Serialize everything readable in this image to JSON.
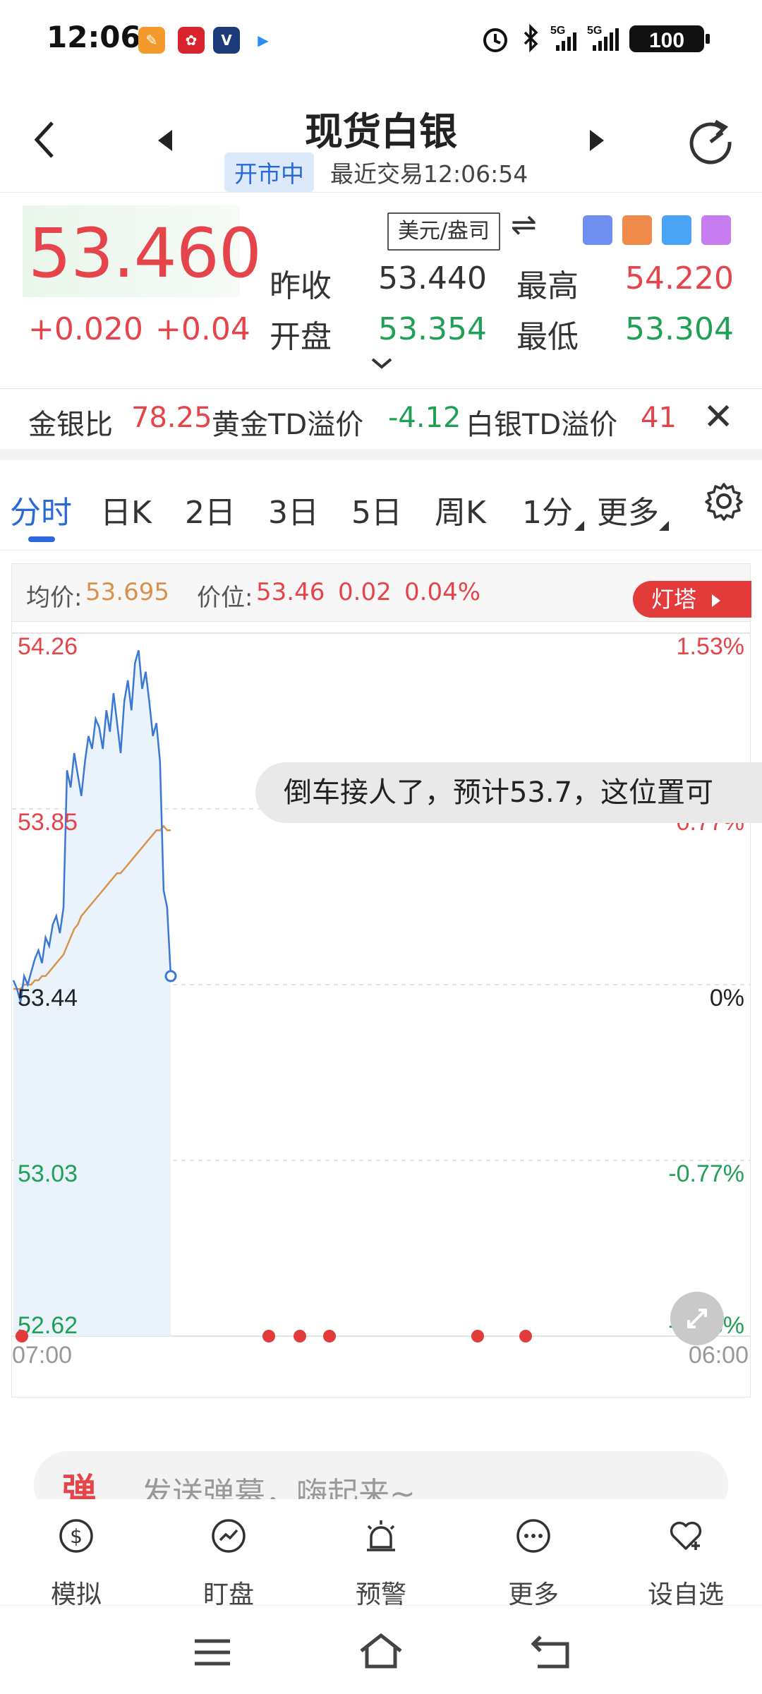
{
  "status_bar": {
    "time": "12:06",
    "battery": "100",
    "network1": "5G",
    "network2": "5G"
  },
  "header": {
    "title": "现货白银",
    "market_status": "开市中",
    "last_trade": "最近交易12:06:54"
  },
  "quote": {
    "price": "53.460",
    "change": "+0.020",
    "change_pct": "+0.04",
    "unit": "美元/盎司",
    "prev_close_label": "昨收",
    "prev_close": "53.440",
    "high_label": "最高",
    "high": "54.220",
    "open_label": "开盘",
    "open": "53.354",
    "low_label": "最低",
    "low": "53.304"
  },
  "ticker": {
    "item1_label": "金银比",
    "item1_value": "78.25",
    "item2_label": "黄金TD溢价",
    "item2_value": "-4.12",
    "item3_label": "白银TD溢价",
    "item3_value": "41"
  },
  "tabs": [
    "分时",
    "日K",
    "2日",
    "3日",
    "5日",
    "周K",
    "1分",
    "更多"
  ],
  "chart_header": {
    "avg_label": "均价:",
    "avg_value": "53.695",
    "pos_label": "价位:",
    "pos_value": "53.46",
    "pos_change": "0.02",
    "pos_pct": "0.04%",
    "dengta_label": "灯塔"
  },
  "comment": "倒车接人了，预计53.7，这位置可",
  "danmu_placeholder": "发送弹幕，嗨起来~",
  "danmu_icon_text": "弹",
  "bottom_nav": [
    "模拟",
    "盯盘",
    "预警",
    "更多",
    "设自选"
  ],
  "colors": {
    "up": "#e5444b",
    "down": "#1fa055",
    "accent": "#2a6ad8",
    "price_line": "#3a78d6",
    "avg_line": "#d9924a"
  },
  "chart_data": {
    "type": "line",
    "title": "",
    "x_start_label": "07:00",
    "x_end_label": "06:00",
    "y_left_ticks": [
      "54.26",
      "53.85",
      "53.44",
      "53.03",
      "52.62"
    ],
    "y_right_ticks": [
      "1.53%",
      "0.77%",
      "0%",
      "-0.77%",
      "-1.53%"
    ],
    "ylim": [
      52.62,
      54.26
    ],
    "grid": true,
    "series": [
      {
        "values": [
          53.45,
          53.43,
          53.4,
          53.46,
          53.44,
          53.47,
          53.5,
          53.52,
          53.49,
          53.55,
          53.53,
          53.58,
          53.6,
          53.56,
          53.62,
          53.94,
          53.9,
          53.98,
          53.93,
          53.88,
          53.96,
          54.02,
          53.99,
          54.06,
          54.04,
          53.99,
          54.08,
          54.03,
          54.12,
          54.05,
          53.98,
          54.1,
          54.15,
          54.08,
          54.19,
          54.22,
          54.13,
          54.17,
          54.1,
          54.02,
          54.05,
          53.96,
          53.66,
          53.62,
          53.46
        ]
      },
      {
        "values": [
          53.43,
          53.43,
          53.43,
          53.44,
          53.44,
          53.44,
          53.45,
          53.45,
          53.46,
          53.46,
          53.47,
          53.48,
          53.49,
          53.5,
          53.51,
          53.53,
          53.55,
          53.57,
          53.58,
          53.6,
          53.61,
          53.62,
          53.63,
          53.64,
          53.65,
          53.66,
          53.67,
          53.68,
          53.69,
          53.7,
          53.7,
          53.71,
          53.72,
          53.73,
          53.74,
          53.75,
          53.76,
          53.77,
          53.78,
          53.79,
          53.8,
          53.8,
          53.81,
          53.8,
          53.8
        ]
      }
    ]
  }
}
